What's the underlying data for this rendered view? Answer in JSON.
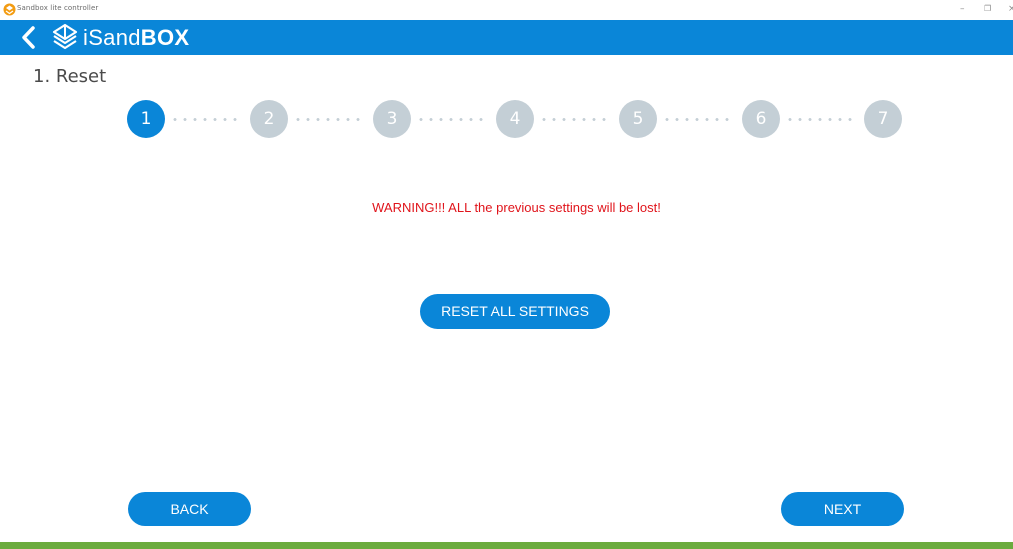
{
  "window": {
    "title": "Sandbox lite controller",
    "minimize_glyph": "–",
    "maximize_glyph": "❐",
    "close_glyph": "×"
  },
  "header": {
    "back_icon": "chevron-left-icon",
    "logo_icon": "isandbox-logo-icon",
    "logo_text_light": "iSand",
    "logo_text_bold": "BOX"
  },
  "page": {
    "title": "1. Reset"
  },
  "stepper": {
    "steps": [
      "1",
      "2",
      "3",
      "4",
      "5",
      "6",
      "7"
    ],
    "active_step": 1
  },
  "warning_text": "WARNING!!! ALL the previous settings will be lost!",
  "buttons": {
    "reset_label": "RESET ALL SETTINGS",
    "back_label": "BACK",
    "next_label": "NEXT"
  },
  "colors": {
    "primary": "#0a86d8",
    "inactive_step": "#c4cfd6",
    "warning": "#e0141b",
    "footer": "#6bab3e"
  }
}
